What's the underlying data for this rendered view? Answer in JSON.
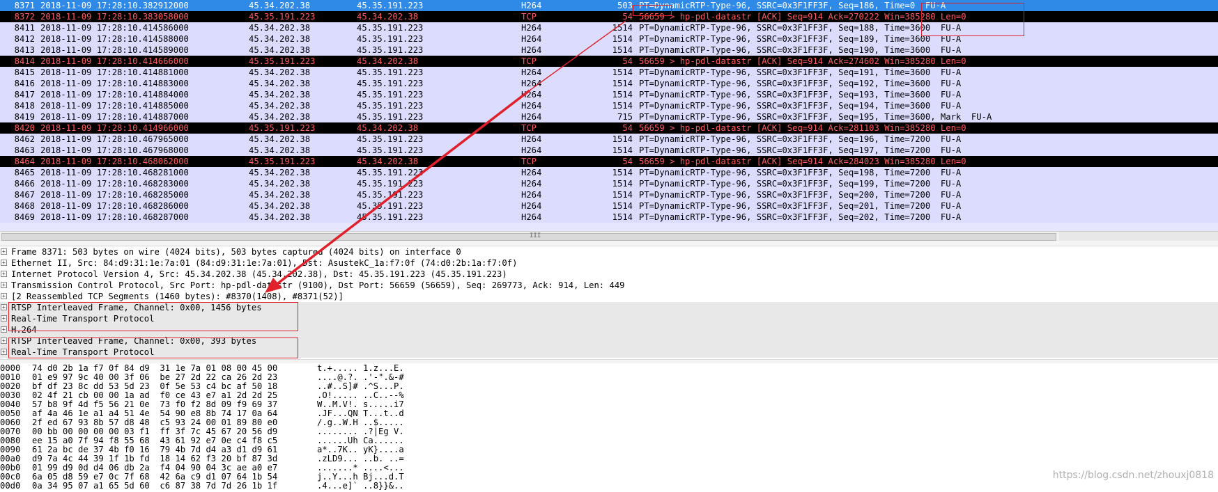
{
  "packets": [
    {
      "no": "8371",
      "time": "2018-11-09 17:28:10.382912000",
      "src": "45.34.202.38",
      "dst": "45.35.191.223",
      "proto": "H264",
      "len": "503",
      "info": "PT=DynamicRTP-Type-96, SSRC=0x3F1FF3F, Seq=186, Time=0  FU-A",
      "style": "sel"
    },
    {
      "no": "8372",
      "time": "2018-11-09 17:28:10.383058000",
      "src": "45.35.191.223",
      "dst": "45.34.202.38",
      "proto": "TCP",
      "len": "54",
      "info": "56659 > hp-pdl-datastr [ACK] Seq=914 Ack=270222 Win=385280 Len=0",
      "style": "tcp"
    },
    {
      "no": "8411",
      "time": "2018-11-09 17:28:10.414586000",
      "src": "45.34.202.38",
      "dst": "45.35.191.223",
      "proto": "H264",
      "len": "1514",
      "info": "PT=DynamicRTP-Type-96, SSRC=0x3F1FF3F, Seq=188, Time=3600  FU-A",
      "style": "h264"
    },
    {
      "no": "8412",
      "time": "2018-11-09 17:28:10.414588000",
      "src": "45.34.202.38",
      "dst": "45.35.191.223",
      "proto": "H264",
      "len": "1514",
      "info": "PT=DynamicRTP-Type-96, SSRC=0x3F1FF3F, Seq=189, Time=3600  FU-A",
      "style": "h264"
    },
    {
      "no": "8413",
      "time": "2018-11-09 17:28:10.414589000",
      "src": "45.34.202.38",
      "dst": "45.35.191.223",
      "proto": "H264",
      "len": "1514",
      "info": "PT=DynamicRTP-Type-96, SSRC=0x3F1FF3F, Seq=190, Time=3600  FU-A",
      "style": "h264"
    },
    {
      "no": "8414",
      "time": "2018-11-09 17:28:10.414666000",
      "src": "45.35.191.223",
      "dst": "45.34.202.38",
      "proto": "TCP",
      "len": "54",
      "info": "56659 > hp-pdl-datastr [ACK] Seq=914 Ack=274602 Win=385280 Len=0",
      "style": "tcp"
    },
    {
      "no": "8415",
      "time": "2018-11-09 17:28:10.414881000",
      "src": "45.34.202.38",
      "dst": "45.35.191.223",
      "proto": "H264",
      "len": "1514",
      "info": "PT=DynamicRTP-Type-96, SSRC=0x3F1FF3F, Seq=191, Time=3600  FU-A",
      "style": "h264"
    },
    {
      "no": "8416",
      "time": "2018-11-09 17:28:10.414883000",
      "src": "45.34.202.38",
      "dst": "45.35.191.223",
      "proto": "H264",
      "len": "1514",
      "info": "PT=DynamicRTP-Type-96, SSRC=0x3F1FF3F, Seq=192, Time=3600  FU-A",
      "style": "h264"
    },
    {
      "no": "8417",
      "time": "2018-11-09 17:28:10.414884000",
      "src": "45.34.202.38",
      "dst": "45.35.191.223",
      "proto": "H264",
      "len": "1514",
      "info": "PT=DynamicRTP-Type-96, SSRC=0x3F1FF3F, Seq=193, Time=3600  FU-A",
      "style": "h264"
    },
    {
      "no": "8418",
      "time": "2018-11-09 17:28:10.414885000",
      "src": "45.34.202.38",
      "dst": "45.35.191.223",
      "proto": "H264",
      "len": "1514",
      "info": "PT=DynamicRTP-Type-96, SSRC=0x3F1FF3F, Seq=194, Time=3600  FU-A",
      "style": "h264"
    },
    {
      "no": "8419",
      "time": "2018-11-09 17:28:10.414887000",
      "src": "45.34.202.38",
      "dst": "45.35.191.223",
      "proto": "H264",
      "len": "715",
      "info": "PT=DynamicRTP-Type-96, SSRC=0x3F1FF3F, Seq=195, Time=3600, Mark  FU-A",
      "style": "h264"
    },
    {
      "no": "8420",
      "time": "2018-11-09 17:28:10.414966000",
      "src": "45.35.191.223",
      "dst": "45.34.202.38",
      "proto": "TCP",
      "len": "54",
      "info": "56659 > hp-pdl-datastr [ACK] Seq=914 Ack=281103 Win=385280 Len=0",
      "style": "tcp"
    },
    {
      "no": "8462",
      "time": "2018-11-09 17:28:10.467965000",
      "src": "45.34.202.38",
      "dst": "45.35.191.223",
      "proto": "H264",
      "len": "1514",
      "info": "PT=DynamicRTP-Type-96, SSRC=0x3F1FF3F, Seq=196, Time=7200  FU-A",
      "style": "h264"
    },
    {
      "no": "8463",
      "time": "2018-11-09 17:28:10.467968000",
      "src": "45.34.202.38",
      "dst": "45.35.191.223",
      "proto": "H264",
      "len": "1514",
      "info": "PT=DynamicRTP-Type-96, SSRC=0x3F1FF3F, Seq=197, Time=7200  FU-A",
      "style": "h264"
    },
    {
      "no": "8464",
      "time": "2018-11-09 17:28:10.468062000",
      "src": "45.35.191.223",
      "dst": "45.34.202.38",
      "proto": "TCP",
      "len": "54",
      "info": "56659 > hp-pdl-datastr [ACK] Seq=914 Ack=284023 Win=385280 Len=0",
      "style": "tcp"
    },
    {
      "no": "8465",
      "time": "2018-11-09 17:28:10.468281000",
      "src": "45.34.202.38",
      "dst": "45.35.191.223",
      "proto": "H264",
      "len": "1514",
      "info": "PT=DynamicRTP-Type-96, SSRC=0x3F1FF3F, Seq=198, Time=7200  FU-A",
      "style": "h264"
    },
    {
      "no": "8466",
      "time": "2018-11-09 17:28:10.468283000",
      "src": "45.34.202.38",
      "dst": "45.35.191.223",
      "proto": "H264",
      "len": "1514",
      "info": "PT=DynamicRTP-Type-96, SSRC=0x3F1FF3F, Seq=199, Time=7200  FU-A",
      "style": "h264"
    },
    {
      "no": "8467",
      "time": "2018-11-09 17:28:10.468285000",
      "src": "45.34.202.38",
      "dst": "45.35.191.223",
      "proto": "H264",
      "len": "1514",
      "info": "PT=DynamicRTP-Type-96, SSRC=0x3F1FF3F, Seq=200, Time=7200  FU-A",
      "style": "h264"
    },
    {
      "no": "8468",
      "time": "2018-11-09 17:28:10.468286000",
      "src": "45.34.202.38",
      "dst": "45.35.191.223",
      "proto": "H264",
      "len": "1514",
      "info": "PT=DynamicRTP-Type-96, SSRC=0x3F1FF3F, Seq=201, Time=7200  FU-A",
      "style": "h264"
    },
    {
      "no": "8469",
      "time": "2018-11-09 17:28:10.468287000",
      "src": "45.34.202.38",
      "dst": "45.35.191.223",
      "proto": "H264",
      "len": "1514",
      "info": "PT=DynamicRTP-Type-96, SSRC=0x3F1FF3F, Seq=202, Time=7200  FU-A",
      "style": "h264"
    }
  ],
  "scrollbar": {
    "grip": "III"
  },
  "details": [
    {
      "text": "Frame 8371: 503 bytes on wire (4024 bits), 503 bytes captured (4024 bits) on interface 0",
      "expander": "+",
      "gray": false
    },
    {
      "text": "Ethernet II, Src: 84:d9:31:1e:7a:01 (84:d9:31:1e:7a:01), Dst: AsustekC_1a:f7:0f (74:d0:2b:1a:f7:0f)",
      "expander": "+",
      "gray": false
    },
    {
      "text": "Internet Protocol Version 4, Src: 45.34.202.38 (45.34.202.38), Dst: 45.35.191.223 (45.35.191.223)",
      "expander": "+",
      "gray": false
    },
    {
      "text": "Transmission Control Protocol, Src Port: hp-pdl-datastr (9100), Dst Port: 56659 (56659), Seq: 269773, Ack: 914, Len: 449",
      "expander": "+",
      "gray": false
    },
    {
      "text": "[2 Reassembled TCP Segments (1460 bytes): #8370(1408), #8371(52)]",
      "expander": "+",
      "gray": false
    },
    {
      "text": "RTSP Interleaved Frame, Channel: 0x00, 1456 bytes",
      "expander": "+",
      "gray": true
    },
    {
      "text": "Real-Time Transport Protocol",
      "expander": "+",
      "gray": true
    },
    {
      "text": "H.264",
      "expander": "+",
      "gray": true
    },
    {
      "text": "RTSP Interleaved Frame, Channel: 0x00, 393 bytes",
      "expander": "+",
      "gray": true
    },
    {
      "text": "Real-Time Transport Protocol",
      "expander": "+",
      "gray": true
    }
  ],
  "hex": [
    {
      "off": "0000",
      "bytes": "74 d0 2b 1a f7 0f 84 d9  31 1e 7a 01 08 00 45 00",
      "ascii": "t.+..... 1.z...E."
    },
    {
      "off": "0010",
      "bytes": "01 e9 97 9c 40 00 3f 06  be 27 2d 22 ca 26 2d 23",
      "ascii": "....@.?. .'-\".&-#"
    },
    {
      "off": "0020",
      "bytes": "bf df 23 8c dd 53 5d 23  0f 5e 53 c4 bc af 50 18",
      "ascii": "..#..S]# .^S...P."
    },
    {
      "off": "0030",
      "bytes": "02 4f 21 cb 00 00 1a ad  f0 ce 43 e7 a1 2d 2d 25",
      "ascii": ".O!..... ..C..--%"
    },
    {
      "off": "0040",
      "bytes": "57 b8 9f 4d f5 56 21 0e  73 f0 f2 8d 09 f9 69 37",
      "ascii": "W..M.V!. s.....i7"
    },
    {
      "off": "0050",
      "bytes": "af 4a 46 1e a1 a4 51 4e  54 90 e8 8b 74 17 0a 64",
      "ascii": ".JF...QN T...t..d"
    },
    {
      "off": "0060",
      "bytes": "2f ed 67 93 8b 57 d8 48  c5 93 24 00 01 89 80 e0",
      "ascii": "/.g..W.H ..$....."
    },
    {
      "off": "0070",
      "bytes": "00 bb 00 00 00 00 03 f1  ff 3f 7c 45 67 20 56 d9",
      "ascii": "........ .?|Eg V."
    },
    {
      "off": "0080",
      "bytes": "ee 15 a0 7f 94 f8 55 68  43 61 92 e7 0e c4 f8 c5",
      "ascii": "......Uh Ca......"
    },
    {
      "off": "0090",
      "bytes": "61 2a bc de 37 4b f0 16  79 4b 7d d4 a3 d1 d9 61",
      "ascii": "a*..7K.. yK}....a"
    },
    {
      "off": "00a0",
      "bytes": "d9 7a 4c 44 39 1f 1b fd  18 14 62 f3 20 bf 87 3d",
      "ascii": ".zLD9... ..b. ..="
    },
    {
      "off": "00b0",
      "bytes": "01 99 d9 0d d4 06 db 2a  f4 04 90 04 3c ae a0 e7",
      "ascii": ".......* ....<..."
    },
    {
      "off": "00c0",
      "bytes": "6a 05 d8 59 e7 0c 7f 68  42 6a c9 d1 07 64 1b 54",
      "ascii": "j..Y...h Bj...d.T"
    },
    {
      "off": "00d0",
      "bytes": "0a 34 95 07 a1 65 5d 60  c6 87 38 7d 7d 26 1b 1f",
      "ascii": ".4...e]` ..8}}&.."
    }
  ],
  "watermark": "https://blog.csdn.net/zhouxj0818",
  "colors": {
    "selected": "#2e8ae6",
    "tcp_row_bg": "#000000",
    "tcp_row_fg": "#ff5c5c",
    "h264_row_bg": "#dcdcff",
    "annotation": "#e0202a"
  }
}
